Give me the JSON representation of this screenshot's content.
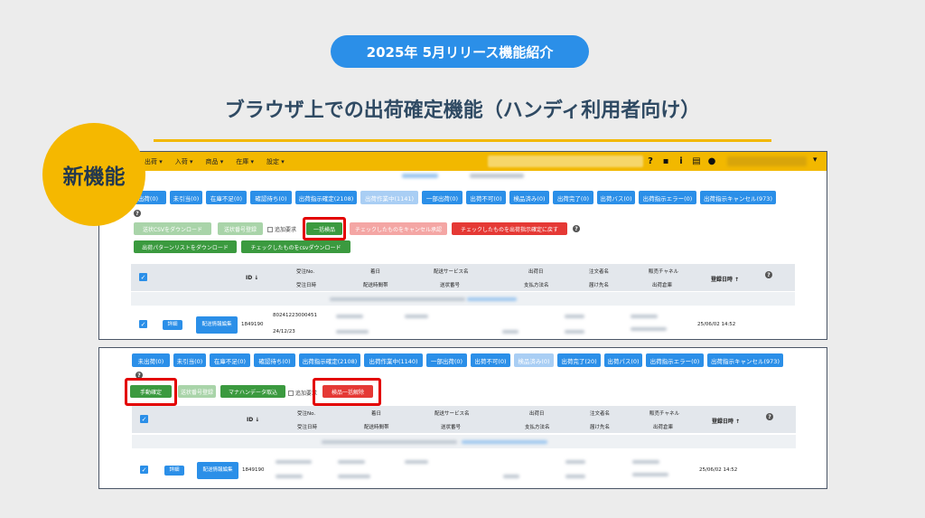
{
  "header": {
    "pill": "2025年 5月リリース機能紹介",
    "title": "ブラウザ上での出荷確定機能（ハンディ利用者向け）",
    "badge": "新機能"
  },
  "colors": {
    "accent": "#2b8fe8",
    "badge": "#f5b800",
    "topbar": "#f2b800",
    "highlight": "#e30000",
    "success": "#3b9a3f",
    "danger": "#e53935"
  },
  "app": {
    "nav": [
      "出荷 ▾",
      "入荷 ▾",
      "商品 ▾",
      "在庫 ▾",
      "設定 ▾"
    ],
    "icons": [
      "help-icon",
      "briefcase-icon",
      "info-icon",
      "report-icon",
      "user-icon"
    ],
    "icon_glyphs": [
      "?",
      "▪",
      "i",
      "▤",
      "●"
    ],
    "caret": "▾"
  },
  "shot1": {
    "tabs": [
      "出荷(0)",
      "未引当(0)",
      "在庫不足(0)",
      "確認待ち(0)",
      "出荷指示確定(2108)",
      "出荷作業中(1141)",
      "一部出荷(0)",
      "出荷不可(0)",
      "検品済み(0)",
      "出荷完了(0)",
      "出荷バス(0)",
      "出荷指示エラー(0)",
      "出荷指示キャンセル(973)"
    ],
    "btn_csv": "送状CSVをダウンロード",
    "btn_register": "送状番号登録",
    "chk_label": "追加要求",
    "btn_bulk": "一括検品",
    "btn_cancel": "チェックしたものをキャンセル承認",
    "btn_return": "チェックしたものを出荷指示確定に戻す",
    "btn_pattern": "出荷パターンリストをダウンロード",
    "btn_checked_csv": "チェックしたものをcsvダウンロード"
  },
  "shot2": {
    "tabs": [
      "未出荷(0)",
      "未引当(0)",
      "在庫不足(0)",
      "確認待ち(0)",
      "出荷指示確定(2108)",
      "出荷作業中(1140)",
      "一部出荷(0)",
      "出荷不可(0)",
      "検品済み(0)",
      "出荷完了(20)",
      "出荷パス(0)",
      "出荷指示エラー(0)",
      "出荷指示キャンセル(973)"
    ],
    "btn_manual": "手動確定",
    "btn_register": "送状番号登録",
    "btn_handy": "マナハンデータ取込",
    "chk_label": "追加要求",
    "btn_release": "検品一括解除"
  },
  "table": {
    "id": "ID ↓",
    "order_no": "受注No.",
    "order_date": "受注日時",
    "arrival": "着日",
    "delivery_time": "配送時間帯",
    "service": "配送サービス名",
    "tracking": "送状番号",
    "ship_date": "出荷日",
    "payment": "支払方法名",
    "orderer": "注文者名",
    "recipient": "届け先名",
    "channel": "販売チャネル",
    "warehouse": "出荷倉庫",
    "registered": "登録日時 ↑",
    "help": "?"
  },
  "row": {
    "detail": "詳細",
    "delivery_edit": "配送情報編集",
    "id": "1849190",
    "order_no": "80241223000451",
    "order_date": "24/12/23",
    "registered": "25/06/02 14:52"
  }
}
